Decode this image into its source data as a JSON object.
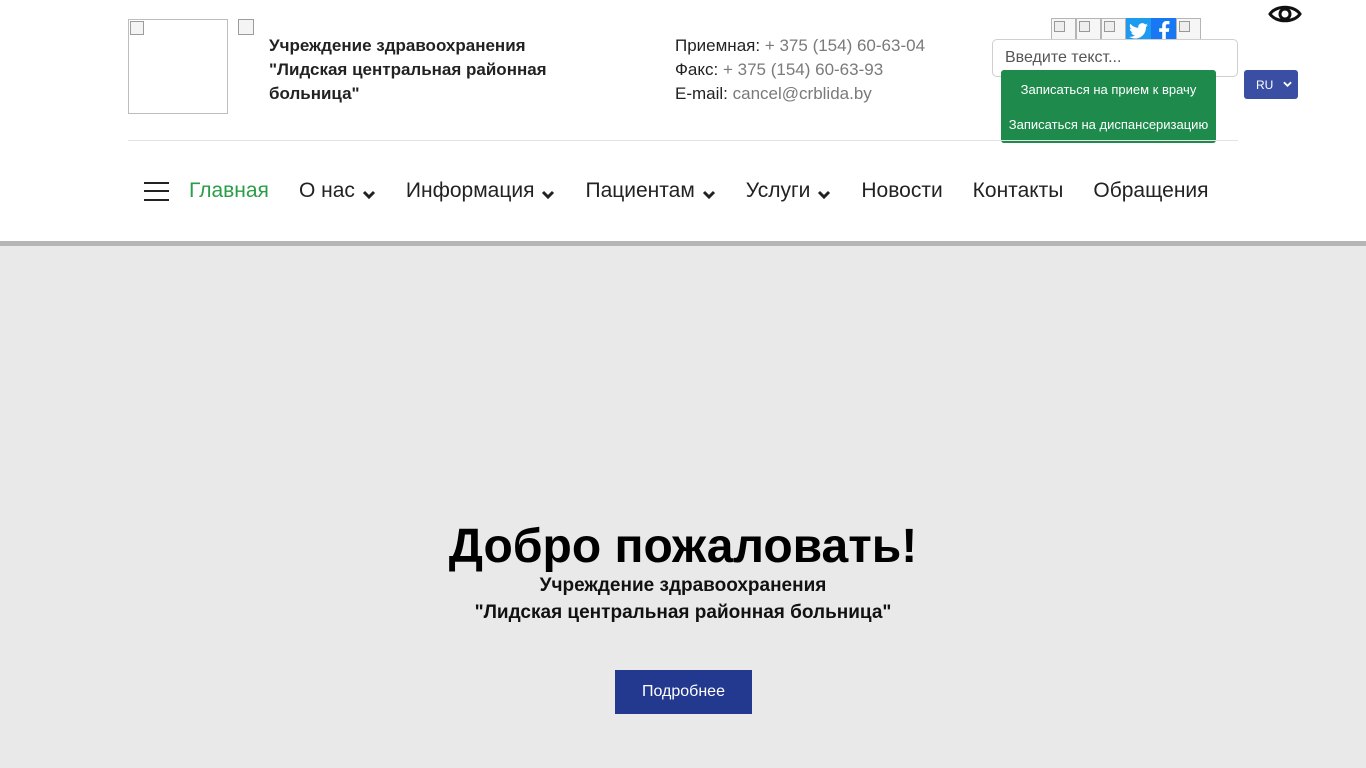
{
  "header": {
    "org_name": "Учреждение здравоохранения\n\"Лидская центральная районная\nбольница\"",
    "contacts": {
      "reception_label": "Приемная:",
      "reception_value": "+ 375 (154) 60-63-04",
      "fax_label": "Факс:",
      "fax_value": "+ 375 (154) 60-63-93",
      "email_label": "E-mail:",
      "email_value": "cancel@crblida.by"
    },
    "search": {
      "placeholder": "Введите текст..."
    },
    "appointment_button": {
      "line1": "Записаться на прием к врачу",
      "line2": "Записаться на диспансеризацию"
    },
    "language": {
      "selected": "RU"
    },
    "social_icons": [
      "broken-image-icon",
      "broken-image-icon",
      "broken-image-icon",
      "twitter-icon",
      "facebook-icon",
      "broken-image-icon"
    ],
    "accessibility_icon": "eye-icon"
  },
  "nav": {
    "items": [
      {
        "label": "Главная",
        "active": true,
        "dropdown": false
      },
      {
        "label": "О нас",
        "active": false,
        "dropdown": true
      },
      {
        "label": "Информация",
        "active": false,
        "dropdown": true
      },
      {
        "label": "Пациентам",
        "active": false,
        "dropdown": true
      },
      {
        "label": "Услуги",
        "active": false,
        "dropdown": true
      },
      {
        "label": "Новости",
        "active": false,
        "dropdown": false
      },
      {
        "label": "Контакты",
        "active": false,
        "dropdown": false
      },
      {
        "label": "Обращения",
        "active": false,
        "dropdown": false
      }
    ]
  },
  "hero": {
    "title": "Добро пожаловать!",
    "subtitle": "Учреждение здравоохранения\n\"Лидская центральная районная больница\"",
    "button_label": "Подробнее"
  },
  "colors": {
    "accent_green": "#1e8a4c",
    "active_nav": "#2a9d48",
    "brand_blue": "#22398f",
    "hero_bg": "#e9e9e9"
  }
}
